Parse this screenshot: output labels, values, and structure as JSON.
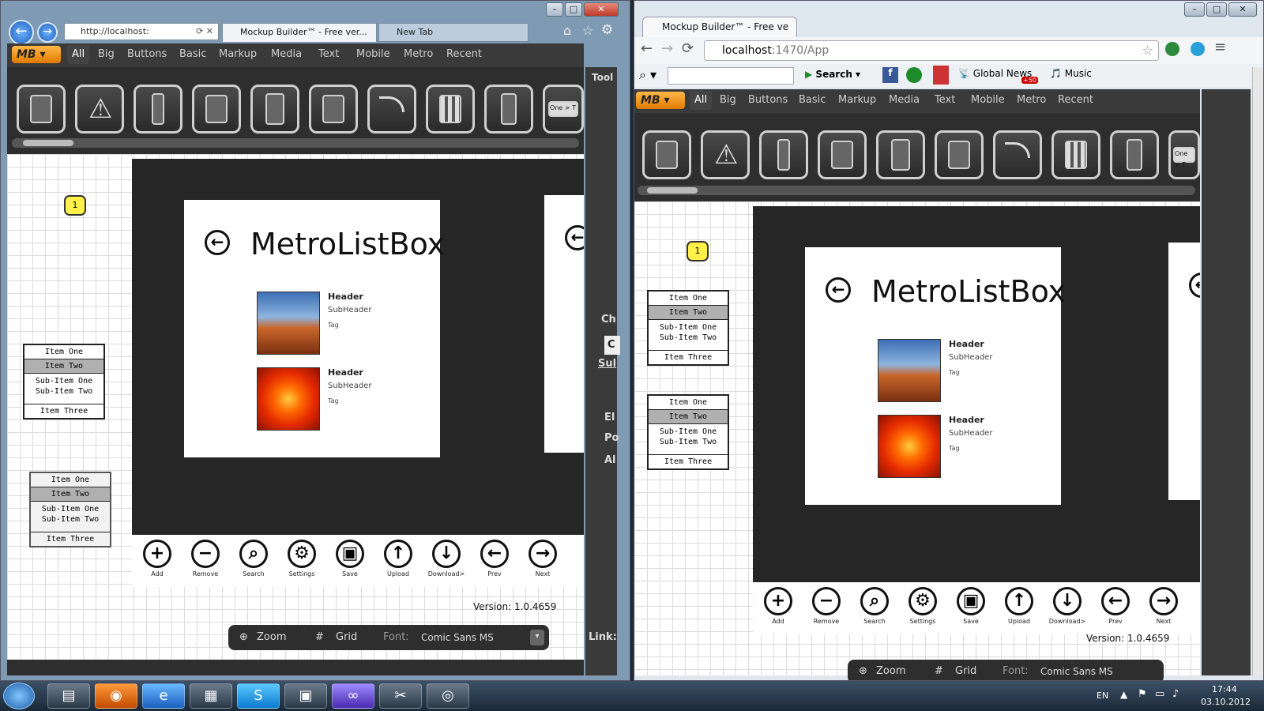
{
  "ie": {
    "address": "http://localhost:",
    "tabs": [
      "Mockup Builder™ - Free ver...",
      "New Tab"
    ]
  },
  "chrome": {
    "tab": "Mockup Builder™ - Free ve",
    "address_host": "localhost",
    "address_path": ":1470/App",
    "search_label": "Search",
    "global_news": "Global News",
    "news_badge": "+50",
    "music": "Music"
  },
  "app": {
    "logo": "MB",
    "categories": [
      "All",
      "Big",
      "Buttons",
      "Basic",
      "Markup",
      "Media",
      "Text",
      "Mobile",
      "Metro",
      "Recent"
    ],
    "toolbox_title": "Tool",
    "toolbox_tail": "One > T",
    "note_number": "1",
    "listbox": {
      "item1": "Item One",
      "item2": "Item Two",
      "sub1": "Sub-Item One",
      "sub2": "Sub-Item Two",
      "item3": "Item Three"
    },
    "metro": {
      "title": "MetroListBox",
      "items": [
        {
          "header": "Header",
          "subheader": "SubHeader",
          "tag": "Tag"
        },
        {
          "header": "Header",
          "subheader": "SubHeader",
          "tag": "Tag"
        }
      ],
      "appbar": [
        "Add",
        "Remove",
        "Search",
        "Settings",
        "Save",
        "Upload",
        "Download>",
        "Prev",
        "Next"
      ]
    },
    "version": "Version: 1.0.4659",
    "zoom": "Zoom",
    "grid": "Grid",
    "font_label": "Font:",
    "font_value": "Comic Sans MS",
    "side_labels": [
      "Ch",
      "C",
      "Sul",
      "El",
      "Po",
      "Al",
      "Link:"
    ]
  },
  "taskbar": {
    "lang": "EN",
    "time": "17:44",
    "date": "03.10.2012"
  }
}
